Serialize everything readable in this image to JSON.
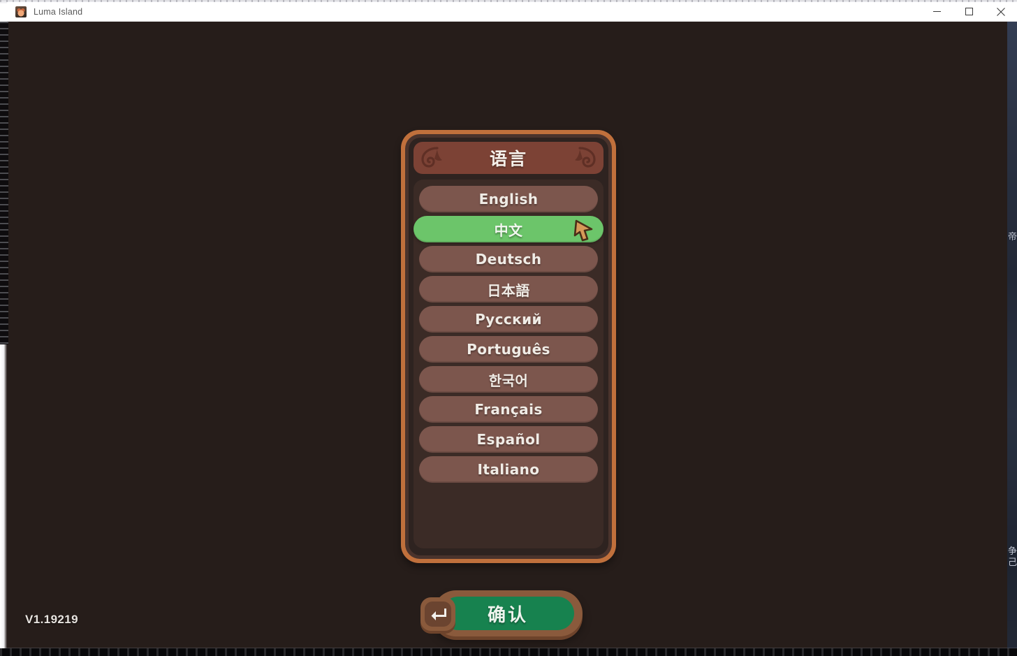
{
  "window": {
    "title": "Luma Island",
    "icon": "app-icon",
    "controls": {
      "minimize": "minimize-icon",
      "maximize": "maximize-icon",
      "close": "close-icon"
    }
  },
  "game": {
    "version": "V1.19219",
    "background_color": "#261d1a"
  },
  "dialog": {
    "title": "语言",
    "frame_color": "#c0703c",
    "body_color": "#2e2320",
    "title_strip_color": "#7c4235",
    "ornament_left": "scroll-swirl-icon",
    "ornament_right": "scroll-swirl-icon",
    "selected_index": 1,
    "item_color": "#7c564d",
    "selected_color": "#6cc56a",
    "languages": [
      {
        "label": "English",
        "selected": false
      },
      {
        "label": "中文",
        "selected": true
      },
      {
        "label": "Deutsch",
        "selected": false
      },
      {
        "label": "日本語",
        "selected": false
      },
      {
        "label": "Русский",
        "selected": false
      },
      {
        "label": "Português",
        "selected": false
      },
      {
        "label": "한국어",
        "selected": false
      },
      {
        "label": "Français",
        "selected": false
      },
      {
        "label": "Español",
        "selected": false
      },
      {
        "label": "Italiano",
        "selected": false
      }
    ]
  },
  "confirm": {
    "label": "确认",
    "key_hint_icon": "enter-key-icon",
    "green_color": "#17824f",
    "shell_color": "#8a5a3c"
  },
  "cursor": {
    "icon": "pointer-arrow-cursor",
    "color": "#d79a58"
  },
  "edges": {
    "right_glyphs": [
      "帝",
      "争",
      "己"
    ]
  }
}
